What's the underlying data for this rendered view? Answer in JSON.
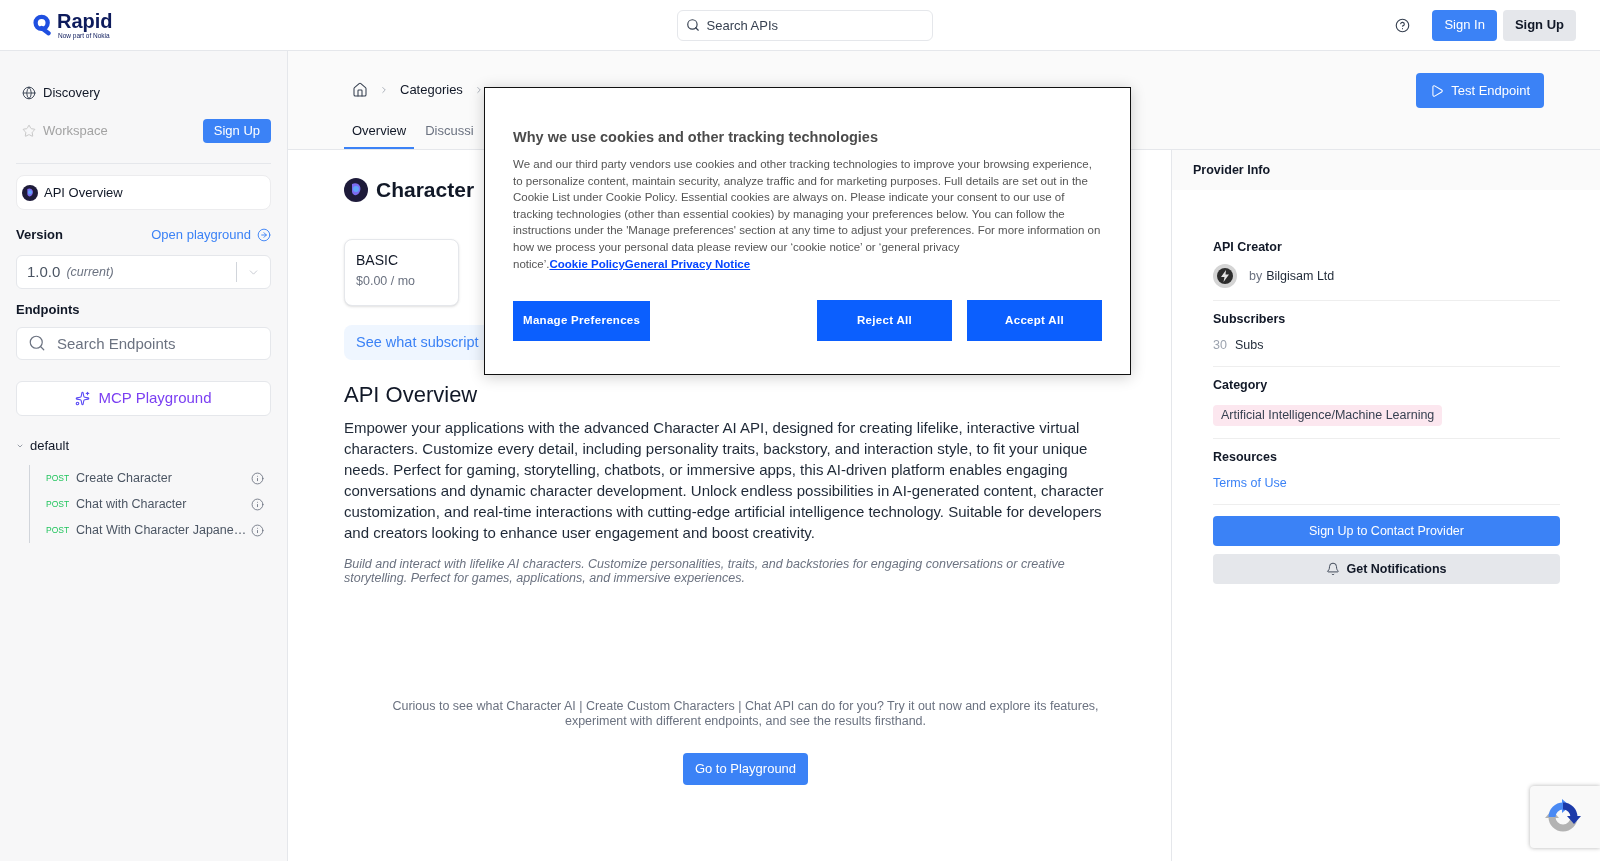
{
  "header": {
    "logo": {
      "name": "Rapid",
      "tagline": "Now part of Nokia"
    },
    "search": {
      "placeholder": "Search APIs"
    },
    "buttons": [
      {
        "label": "Sign In",
        "kind": "primary"
      },
      {
        "label": "Sign Up",
        "kind": "secondary"
      }
    ]
  },
  "sidebar": {
    "nav": [
      {
        "label": "Discovery",
        "disabled": false
      },
      {
        "label": "Workspace",
        "disabled": true
      }
    ],
    "signup_button": "Sign Up",
    "api_overview": {
      "label": "API Overview",
      "selected": true
    },
    "version": {
      "label": "Version",
      "link": "Open playground",
      "value": "1.0.0",
      "note": "(current)"
    },
    "endpoints": {
      "label": "Endpoints",
      "search": {
        "placeholder": "Search Endpoints"
      },
      "mcp_button": "MCP Playground",
      "groups": [
        {
          "label": "default",
          "expanded": true,
          "children": [
            {
              "method": "POST",
              "label": "Create Character",
              "selected": false
            },
            {
              "method": "POST",
              "label": "Chat with Character",
              "selected": false
            },
            {
              "method": "POST",
              "label": "Chat With Character Japane…",
              "selected": false
            }
          ]
        }
      ]
    }
  },
  "breadcrumb": {
    "items": [
      {
        "label": "Categories"
      }
    ]
  },
  "tabs": [
    {
      "label": "Overview",
      "selected": true
    },
    {
      "label": "Discussi",
      "selected": false
    }
  ],
  "test_button": "Test Endpoint",
  "api": {
    "title": "Character",
    "plans": [
      {
        "name": "BASIC",
        "price": "$0.00 / mo"
      }
    ],
    "plans_banner": "See what subscript",
    "overview": {
      "heading": "API Overview",
      "description": "Empower your applications with the advanced Character AI API, designed for creating lifelike, interactive virtual characters. Customize every detail, including personality traits, backstory, and interaction style, to fit your unique needs. Perfect for gaming, storytelling, chatbots, or immersive apps, this AI-driven platform enables engaging conversations and dynamic character development. Unlock endless possibilities in AI-generated content, character customization, and real-time interactions with cutting-edge artificial intelligence technology. Suitable for developers and creators looking to enhance user engagement and boost creativity.",
      "summary": "Build and interact with lifelike AI characters. Customize personalities, traits, and backstories for engaging conversations or creative storytelling. Perfect for games, applications, and immersive experiences."
    },
    "cta": {
      "text": "Curious to see what Character AI | Create Custom Characters | Chat API can do for you? Try it out now and explore its features, experiment with different endpoints, and see the results firsthand.",
      "button": "Go to Playground"
    }
  },
  "provider": {
    "title": "Provider Info",
    "sections": [
      {
        "kind": "creator",
        "heading": "API Creator",
        "prefix": "by",
        "value": "Bilgisam Ltd"
      },
      {
        "kind": "count",
        "heading": "Subscribers",
        "count": "30",
        "value": "Subs"
      },
      {
        "kind": "tag",
        "heading": "Category",
        "value": "Artificial Intelligence/Machine Learning"
      },
      {
        "kind": "link",
        "heading": "Resources",
        "value": "Terms of Use"
      }
    ],
    "buttons": [
      {
        "label": "Sign Up to Contact Provider",
        "kind": "primary"
      },
      {
        "label": "Get Notifications",
        "kind": "secondary"
      }
    ]
  },
  "cookie_dialog": {
    "title": "Why we use cookies and other tracking technologies",
    "text": "We and our third party vendors use cookies and other tracking technologies to improve your browsing experience, to personalize content, maintain security, analyze traffic and for marketing purposes. Full details are set out in the Cookie List under Cookie Policy. Essential cookies are always on. Please indicate your consent to our use of tracking technologies (other than essential cookies) by managing your preferences below. You can follow the instructions under the 'Manage preferences' section at any time to adjust your preferences. For more information on how we process your personal data please review our ‘cookie notice’ or ‘general privacy notice’.",
    "links": [
      "Cookie Policy",
      "General Privacy Notice"
    ],
    "buttons": [
      {
        "label": "Manage Preferences"
      },
      {
        "label": "Reject All"
      },
      {
        "label": "Accept All"
      }
    ]
  }
}
